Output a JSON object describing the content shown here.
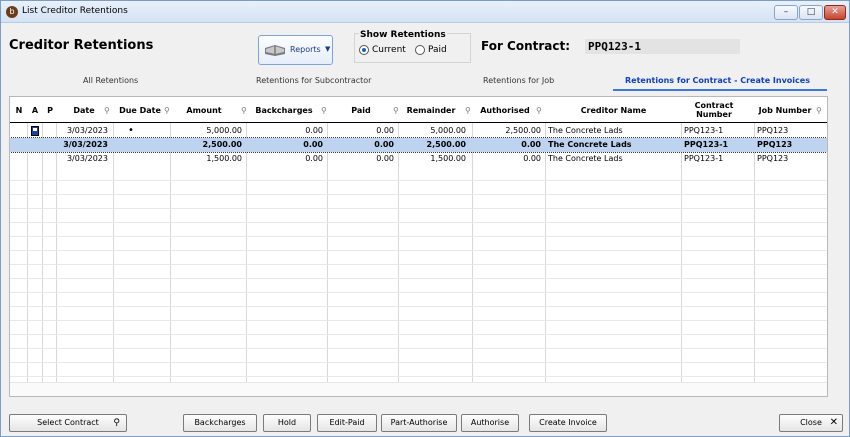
{
  "window": {
    "title": "List Creditor Retentions",
    "app_icon": "app-logo-icon"
  },
  "header": {
    "page_title": "Creditor Retentions",
    "reports_label": "Reports",
    "show_retentions": {
      "legend": "Show Retentions",
      "options": [
        "Current",
        "Paid"
      ],
      "selected": "Current"
    },
    "contract_label": "For Contract:",
    "contract_value": "PPQ123-1"
  },
  "tabs": [
    {
      "label": "All Retentions",
      "active": false
    },
    {
      "label": "Retentions for Subcontractor",
      "active": false
    },
    {
      "label": "Retentions for Job",
      "active": false
    },
    {
      "label": "Retentions for Contract - Create Invoices",
      "active": true
    }
  ],
  "table": {
    "columns": {
      "n": "N",
      "a": "A",
      "p": "P",
      "date": "Date",
      "due_date": "Due Date",
      "amount": "Amount",
      "backcharges": "Backcharges",
      "paid": "Paid",
      "remainder": "Remainder",
      "authorised": "Authorised",
      "creditor_name": "Creditor Name",
      "contract_number": "Contract Number",
      "job_number": "Job Number"
    },
    "rows": [
      {
        "date": "3/03/2023",
        "due_date": "•",
        "amount": "5,000.00",
        "backcharges": "0.00",
        "paid": "0.00",
        "remainder": "5,000.00",
        "authorised": "2,500.00",
        "creditor_name": "The Concrete Lads",
        "contract_number": "PPQ123-1",
        "job_number": "PPQ123"
      },
      {
        "date": "3/03/2023",
        "due_date": "",
        "amount": "2,500.00",
        "backcharges": "0.00",
        "paid": "0.00",
        "remainder": "2,500.00",
        "authorised": "0.00",
        "creditor_name": "The Concrete Lads",
        "contract_number": "PPQ123-1",
        "job_number": "PPQ123"
      },
      {
        "date": "3/03/2023",
        "due_date": "",
        "amount": "1,500.00",
        "backcharges": "0.00",
        "paid": "0.00",
        "remainder": "1,500.00",
        "authorised": "0.00",
        "creditor_name": "The Concrete Lads",
        "contract_number": "PPQ123-1",
        "job_number": "PPQ123"
      }
    ]
  },
  "footer": {
    "select_contract": "Select Contract",
    "backcharges": "Backcharges",
    "hold": "Hold",
    "edit_paid": "Edit-Paid",
    "part_authorise": "Part-Authorise",
    "authorise": "Authorise",
    "create_invoice": "Create Invoice",
    "close": "Close"
  }
}
